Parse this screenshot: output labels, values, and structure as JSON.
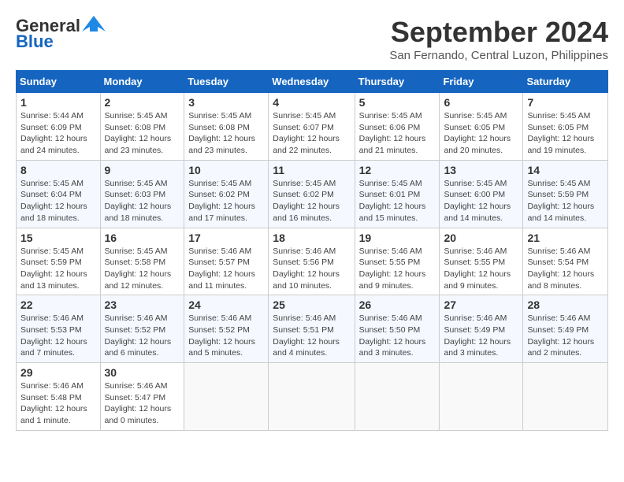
{
  "header": {
    "logo_line1": "General",
    "logo_line2": "Blue",
    "month": "September 2024",
    "location": "San Fernando, Central Luzon, Philippines"
  },
  "weekdays": [
    "Sunday",
    "Monday",
    "Tuesday",
    "Wednesday",
    "Thursday",
    "Friday",
    "Saturday"
  ],
  "weeks": [
    [
      {
        "day": "1",
        "info": "Sunrise: 5:44 AM\nSunset: 6:09 PM\nDaylight: 12 hours\nand 24 minutes."
      },
      {
        "day": "2",
        "info": "Sunrise: 5:45 AM\nSunset: 6:08 PM\nDaylight: 12 hours\nand 23 minutes."
      },
      {
        "day": "3",
        "info": "Sunrise: 5:45 AM\nSunset: 6:08 PM\nDaylight: 12 hours\nand 23 minutes."
      },
      {
        "day": "4",
        "info": "Sunrise: 5:45 AM\nSunset: 6:07 PM\nDaylight: 12 hours\nand 22 minutes."
      },
      {
        "day": "5",
        "info": "Sunrise: 5:45 AM\nSunset: 6:06 PM\nDaylight: 12 hours\nand 21 minutes."
      },
      {
        "day": "6",
        "info": "Sunrise: 5:45 AM\nSunset: 6:05 PM\nDaylight: 12 hours\nand 20 minutes."
      },
      {
        "day": "7",
        "info": "Sunrise: 5:45 AM\nSunset: 6:05 PM\nDaylight: 12 hours\nand 19 minutes."
      }
    ],
    [
      {
        "day": "8",
        "info": "Sunrise: 5:45 AM\nSunset: 6:04 PM\nDaylight: 12 hours\nand 18 minutes."
      },
      {
        "day": "9",
        "info": "Sunrise: 5:45 AM\nSunset: 6:03 PM\nDaylight: 12 hours\nand 18 minutes."
      },
      {
        "day": "10",
        "info": "Sunrise: 5:45 AM\nSunset: 6:02 PM\nDaylight: 12 hours\nand 17 minutes."
      },
      {
        "day": "11",
        "info": "Sunrise: 5:45 AM\nSunset: 6:02 PM\nDaylight: 12 hours\nand 16 minutes."
      },
      {
        "day": "12",
        "info": "Sunrise: 5:45 AM\nSunset: 6:01 PM\nDaylight: 12 hours\nand 15 minutes."
      },
      {
        "day": "13",
        "info": "Sunrise: 5:45 AM\nSunset: 6:00 PM\nDaylight: 12 hours\nand 14 minutes."
      },
      {
        "day": "14",
        "info": "Sunrise: 5:45 AM\nSunset: 5:59 PM\nDaylight: 12 hours\nand 14 minutes."
      }
    ],
    [
      {
        "day": "15",
        "info": "Sunrise: 5:45 AM\nSunset: 5:59 PM\nDaylight: 12 hours\nand 13 minutes."
      },
      {
        "day": "16",
        "info": "Sunrise: 5:45 AM\nSunset: 5:58 PM\nDaylight: 12 hours\nand 12 minutes."
      },
      {
        "day": "17",
        "info": "Sunrise: 5:46 AM\nSunset: 5:57 PM\nDaylight: 12 hours\nand 11 minutes."
      },
      {
        "day": "18",
        "info": "Sunrise: 5:46 AM\nSunset: 5:56 PM\nDaylight: 12 hours\nand 10 minutes."
      },
      {
        "day": "19",
        "info": "Sunrise: 5:46 AM\nSunset: 5:55 PM\nDaylight: 12 hours\nand 9 minutes."
      },
      {
        "day": "20",
        "info": "Sunrise: 5:46 AM\nSunset: 5:55 PM\nDaylight: 12 hours\nand 9 minutes."
      },
      {
        "day": "21",
        "info": "Sunrise: 5:46 AM\nSunset: 5:54 PM\nDaylight: 12 hours\nand 8 minutes."
      }
    ],
    [
      {
        "day": "22",
        "info": "Sunrise: 5:46 AM\nSunset: 5:53 PM\nDaylight: 12 hours\nand 7 minutes."
      },
      {
        "day": "23",
        "info": "Sunrise: 5:46 AM\nSunset: 5:52 PM\nDaylight: 12 hours\nand 6 minutes."
      },
      {
        "day": "24",
        "info": "Sunrise: 5:46 AM\nSunset: 5:52 PM\nDaylight: 12 hours\nand 5 minutes."
      },
      {
        "day": "25",
        "info": "Sunrise: 5:46 AM\nSunset: 5:51 PM\nDaylight: 12 hours\nand 4 minutes."
      },
      {
        "day": "26",
        "info": "Sunrise: 5:46 AM\nSunset: 5:50 PM\nDaylight: 12 hours\nand 3 minutes."
      },
      {
        "day": "27",
        "info": "Sunrise: 5:46 AM\nSunset: 5:49 PM\nDaylight: 12 hours\nand 3 minutes."
      },
      {
        "day": "28",
        "info": "Sunrise: 5:46 AM\nSunset: 5:49 PM\nDaylight: 12 hours\nand 2 minutes."
      }
    ],
    [
      {
        "day": "29",
        "info": "Sunrise: 5:46 AM\nSunset: 5:48 PM\nDaylight: 12 hours\nand 1 minute."
      },
      {
        "day": "30",
        "info": "Sunrise: 5:46 AM\nSunset: 5:47 PM\nDaylight: 12 hours\nand 0 minutes."
      },
      {
        "day": "",
        "info": ""
      },
      {
        "day": "",
        "info": ""
      },
      {
        "day": "",
        "info": ""
      },
      {
        "day": "",
        "info": ""
      },
      {
        "day": "",
        "info": ""
      }
    ]
  ]
}
